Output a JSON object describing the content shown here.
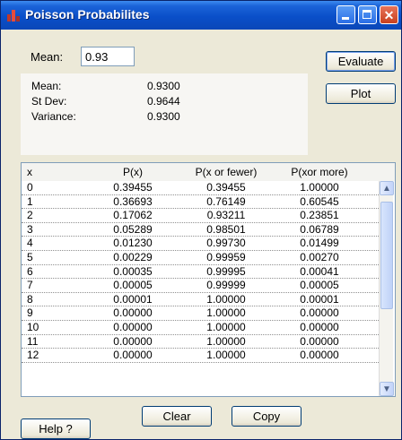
{
  "window": {
    "title": "Poisson Probabilites"
  },
  "mean": {
    "label": "Mean:",
    "value": "0.93"
  },
  "buttons": {
    "evaluate": "Evaluate",
    "plot": "Plot",
    "clear": "Clear",
    "copy": "Copy",
    "help": "Help ?"
  },
  "stats": [
    {
      "label": "Mean:",
      "value": "0.9300"
    },
    {
      "label": "St Dev:",
      "value": "0.9644"
    },
    {
      "label": "Variance:",
      "value": "0.9300"
    }
  ],
  "table": {
    "columns": [
      "x",
      "P(x)",
      "P(x or fewer)",
      "P(xor more)"
    ],
    "rows": [
      [
        "0",
        "0.39455",
        "0.39455",
        "1.00000"
      ],
      [
        "1",
        "0.36693",
        "0.76149",
        "0.60545"
      ],
      [
        "2",
        "0.17062",
        "0.93211",
        "0.23851"
      ],
      [
        "3",
        "0.05289",
        "0.98501",
        "0.06789"
      ],
      [
        "4",
        "0.01230",
        "0.99730",
        "0.01499"
      ],
      [
        "5",
        "0.00229",
        "0.99959",
        "0.00270"
      ],
      [
        "6",
        "0.00035",
        "0.99995",
        "0.00041"
      ],
      [
        "7",
        "0.00005",
        "0.99999",
        "0.00005"
      ],
      [
        "8",
        "0.00001",
        "1.00000",
        "0.00001"
      ],
      [
        "9",
        "0.00000",
        "1.00000",
        "0.00000"
      ],
      [
        "10",
        "0.00000",
        "1.00000",
        "0.00000"
      ],
      [
        "11",
        "0.00000",
        "1.00000",
        "0.00000"
      ],
      [
        "12",
        "0.00000",
        "1.00000",
        "0.00000"
      ]
    ]
  },
  "icons": {
    "up": "up-arrow-icon",
    "down": "down-arrow-icon",
    "app": "app-icon",
    "min": "minimize-icon",
    "max": "maximize-icon",
    "close": "close-icon"
  }
}
